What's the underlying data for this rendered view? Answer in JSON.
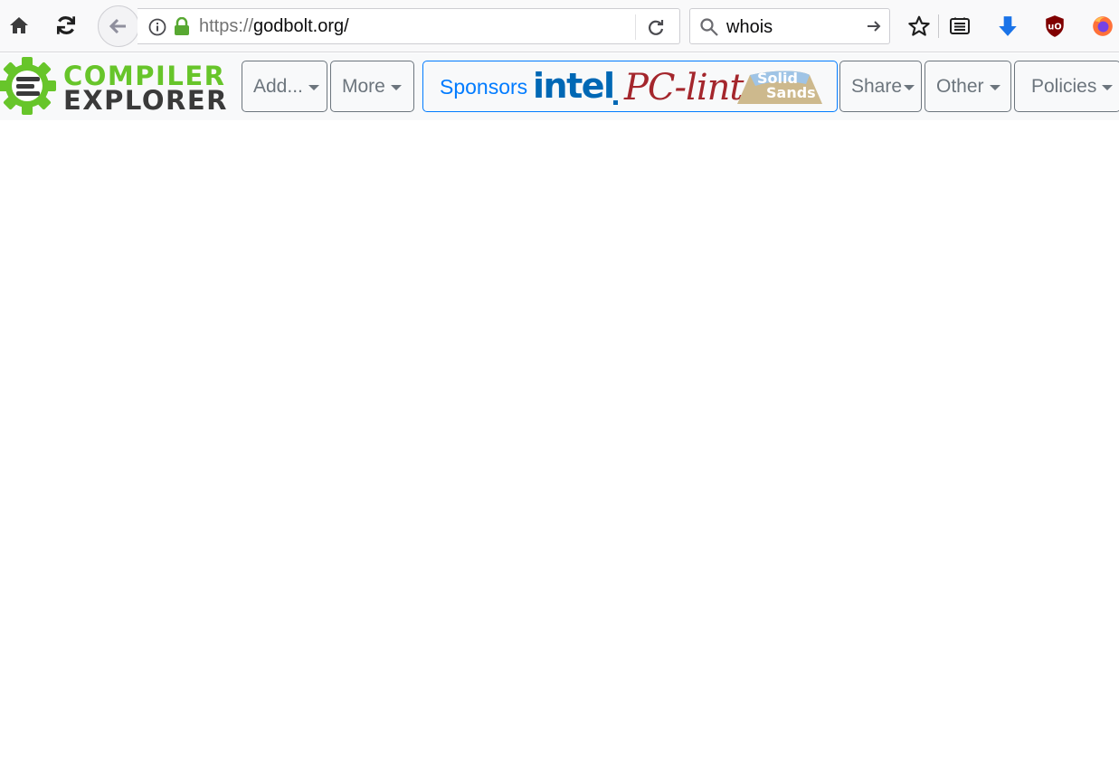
{
  "browser": {
    "url_scheme": "https://",
    "url_host": "godbolt.org/",
    "search_value": "whois",
    "icons": {
      "home": "home-icon",
      "reload": "reload-icon",
      "back": "back-arrow-icon",
      "info": "info-icon",
      "lock": "lock-icon",
      "url_reload": "url-reload-icon",
      "search": "search-icon",
      "go": "go-arrow-icon",
      "bookmark": "star-icon",
      "reader": "reader-view-icon",
      "download": "download-arrow-icon",
      "ublock": "ublock-origin-icon",
      "firefox": "firefox-icon"
    },
    "colors": {
      "lock": "#58a832",
      "download": "#1a73e8",
      "ublock": "#800000"
    }
  },
  "site": {
    "logo_line1": "COMPILER",
    "logo_line2": "EXPLORER",
    "logo_colors": {
      "gear": "#67c52a",
      "text_dark": "#3a3a3a"
    },
    "nav": {
      "add_label": "Add...",
      "more_label": "More",
      "sponsors_label": "Sponsors",
      "sponsor_intel": "intel",
      "sponsor_pclint": "PC-lint",
      "sponsor_solid_1": "Solid",
      "sponsor_solid_2": "Sands",
      "share_label": "Share",
      "other_label": "Other",
      "policies_label": "Policies"
    },
    "colors": {
      "button_border": "#6c757d",
      "sponsor_blue": "#007bff",
      "intel_blue": "#0068b5",
      "pclint_red": "#a4262c"
    }
  }
}
